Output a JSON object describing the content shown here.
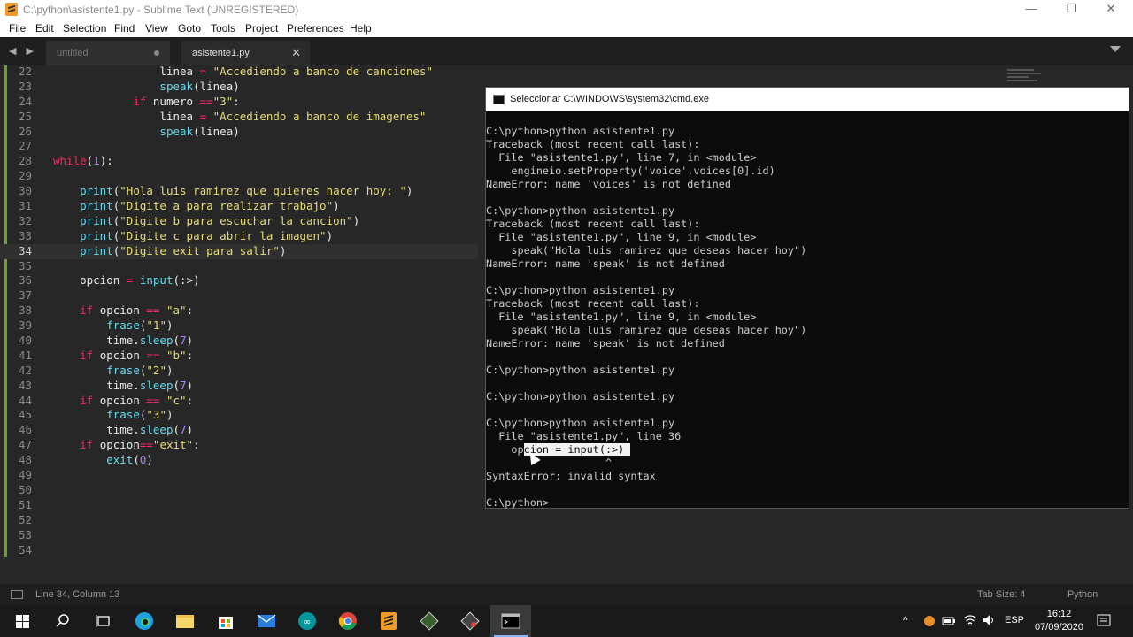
{
  "window": {
    "title": "C:\\python\\asistente1.py - Sublime Text (UNREGISTERED)",
    "minimize": "—",
    "restore": "❐",
    "close": "✕"
  },
  "menu": [
    "File",
    "Edit",
    "Selection",
    "Find",
    "View",
    "Goto",
    "Tools",
    "Project",
    "Preferences",
    "Help"
  ],
  "tabs": {
    "arrows": "◀ ▶",
    "inactive_label": "untitled",
    "active_label": "asistente1.py",
    "close": "✕"
  },
  "code_lines": [
    {
      "n": "22",
      "t": "                linea = \"Accediendo a banco de canciones\""
    },
    {
      "n": "23",
      "t": "                speak(linea)"
    },
    {
      "n": "24",
      "t": "            if numero ==\"3\":"
    },
    {
      "n": "25",
      "t": "                linea = \"Accediendo a banco de imagenes\""
    },
    {
      "n": "26",
      "t": "                speak(linea)"
    },
    {
      "n": "27",
      "t": ""
    },
    {
      "n": "28",
      "t": "while(1):"
    },
    {
      "n": "29",
      "t": ""
    },
    {
      "n": "30",
      "t": "    print(\"Hola luis ramirez que quieres hacer hoy: \")"
    },
    {
      "n": "31",
      "t": "    print(\"Digite a para realizar trabajo\")"
    },
    {
      "n": "32",
      "t": "    print(\"Digite b para escuchar la cancion\")"
    },
    {
      "n": "33",
      "t": "    print(\"Digite c para abrir la imagen\")"
    },
    {
      "n": "34",
      "t": "    print(\"Digite exit para salir\")"
    },
    {
      "n": "35",
      "t": ""
    },
    {
      "n": "36",
      "t": "    opcion = input(:>)"
    },
    {
      "n": "37",
      "t": ""
    },
    {
      "n": "38",
      "t": "    if opcion == \"a\":"
    },
    {
      "n": "39",
      "t": "        frase(\"1\")"
    },
    {
      "n": "40",
      "t": "        time.sleep(7)"
    },
    {
      "n": "41",
      "t": "    if opcion == \"b\":"
    },
    {
      "n": "42",
      "t": "        frase(\"2\")"
    },
    {
      "n": "43",
      "t": "        time.sleep(7)"
    },
    {
      "n": "44",
      "t": "    if opcion == \"c\":"
    },
    {
      "n": "45",
      "t": "        frase(\"3\")"
    },
    {
      "n": "46",
      "t": "        time.sleep(7)"
    },
    {
      "n": "47",
      "t": "    if opcion==\"exit\":"
    },
    {
      "n": "48",
      "t": "        exit(0)"
    },
    {
      "n": "49",
      "t": ""
    },
    {
      "n": "50",
      "t": ""
    },
    {
      "n": "51",
      "t": ""
    },
    {
      "n": "52",
      "t": ""
    },
    {
      "n": "53",
      "t": ""
    },
    {
      "n": "54",
      "t": ""
    }
  ],
  "current_line": "34",
  "cmd": {
    "title": "Seleccionar C:\\WINDOWS\\system32\\cmd.exe",
    "lines": [
      "C:\\python>python asistente1.py",
      "Traceback (most recent call last):",
      "  File \"asistente1.py\", line 7, in <module>",
      "    engineio.setProperty('voice',voices[0].id)",
      "NameError: name 'voices' is not defined",
      "",
      "C:\\python>python asistente1.py",
      "Traceback (most recent call last):",
      "  File \"asistente1.py\", line 9, in <module>",
      "    speak(\"Hola luis ramirez que deseas hacer hoy\")",
      "NameError: name 'speak' is not defined",
      "",
      "C:\\python>python asistente1.py",
      "Traceback (most recent call last):",
      "  File \"asistente1.py\", line 9, in <module>",
      "    speak(\"Hola luis ramirez que deseas hacer hoy\")",
      "NameError: name 'speak' is not defined",
      "",
      "C:\\python>python asistente1.py",
      "",
      "C:\\python>python asistente1.py",
      "",
      "C:\\python>python asistente1.py",
      "  File \"asistente1.py\", line 36",
      "__SEL__",
      "                   ^",
      "SyntaxError: invalid syntax",
      "",
      "C:\\python>"
    ],
    "sel_prefix": "    op",
    "sel_text": "cion = input(:>) "
  },
  "status": {
    "position": "Line 34, Column 13",
    "tab_size": "Tab Size: 4",
    "syntax": "Python"
  },
  "taskbar": {
    "tray_lang": "ESP",
    "time": "16:12",
    "date": "07/09/2020"
  }
}
